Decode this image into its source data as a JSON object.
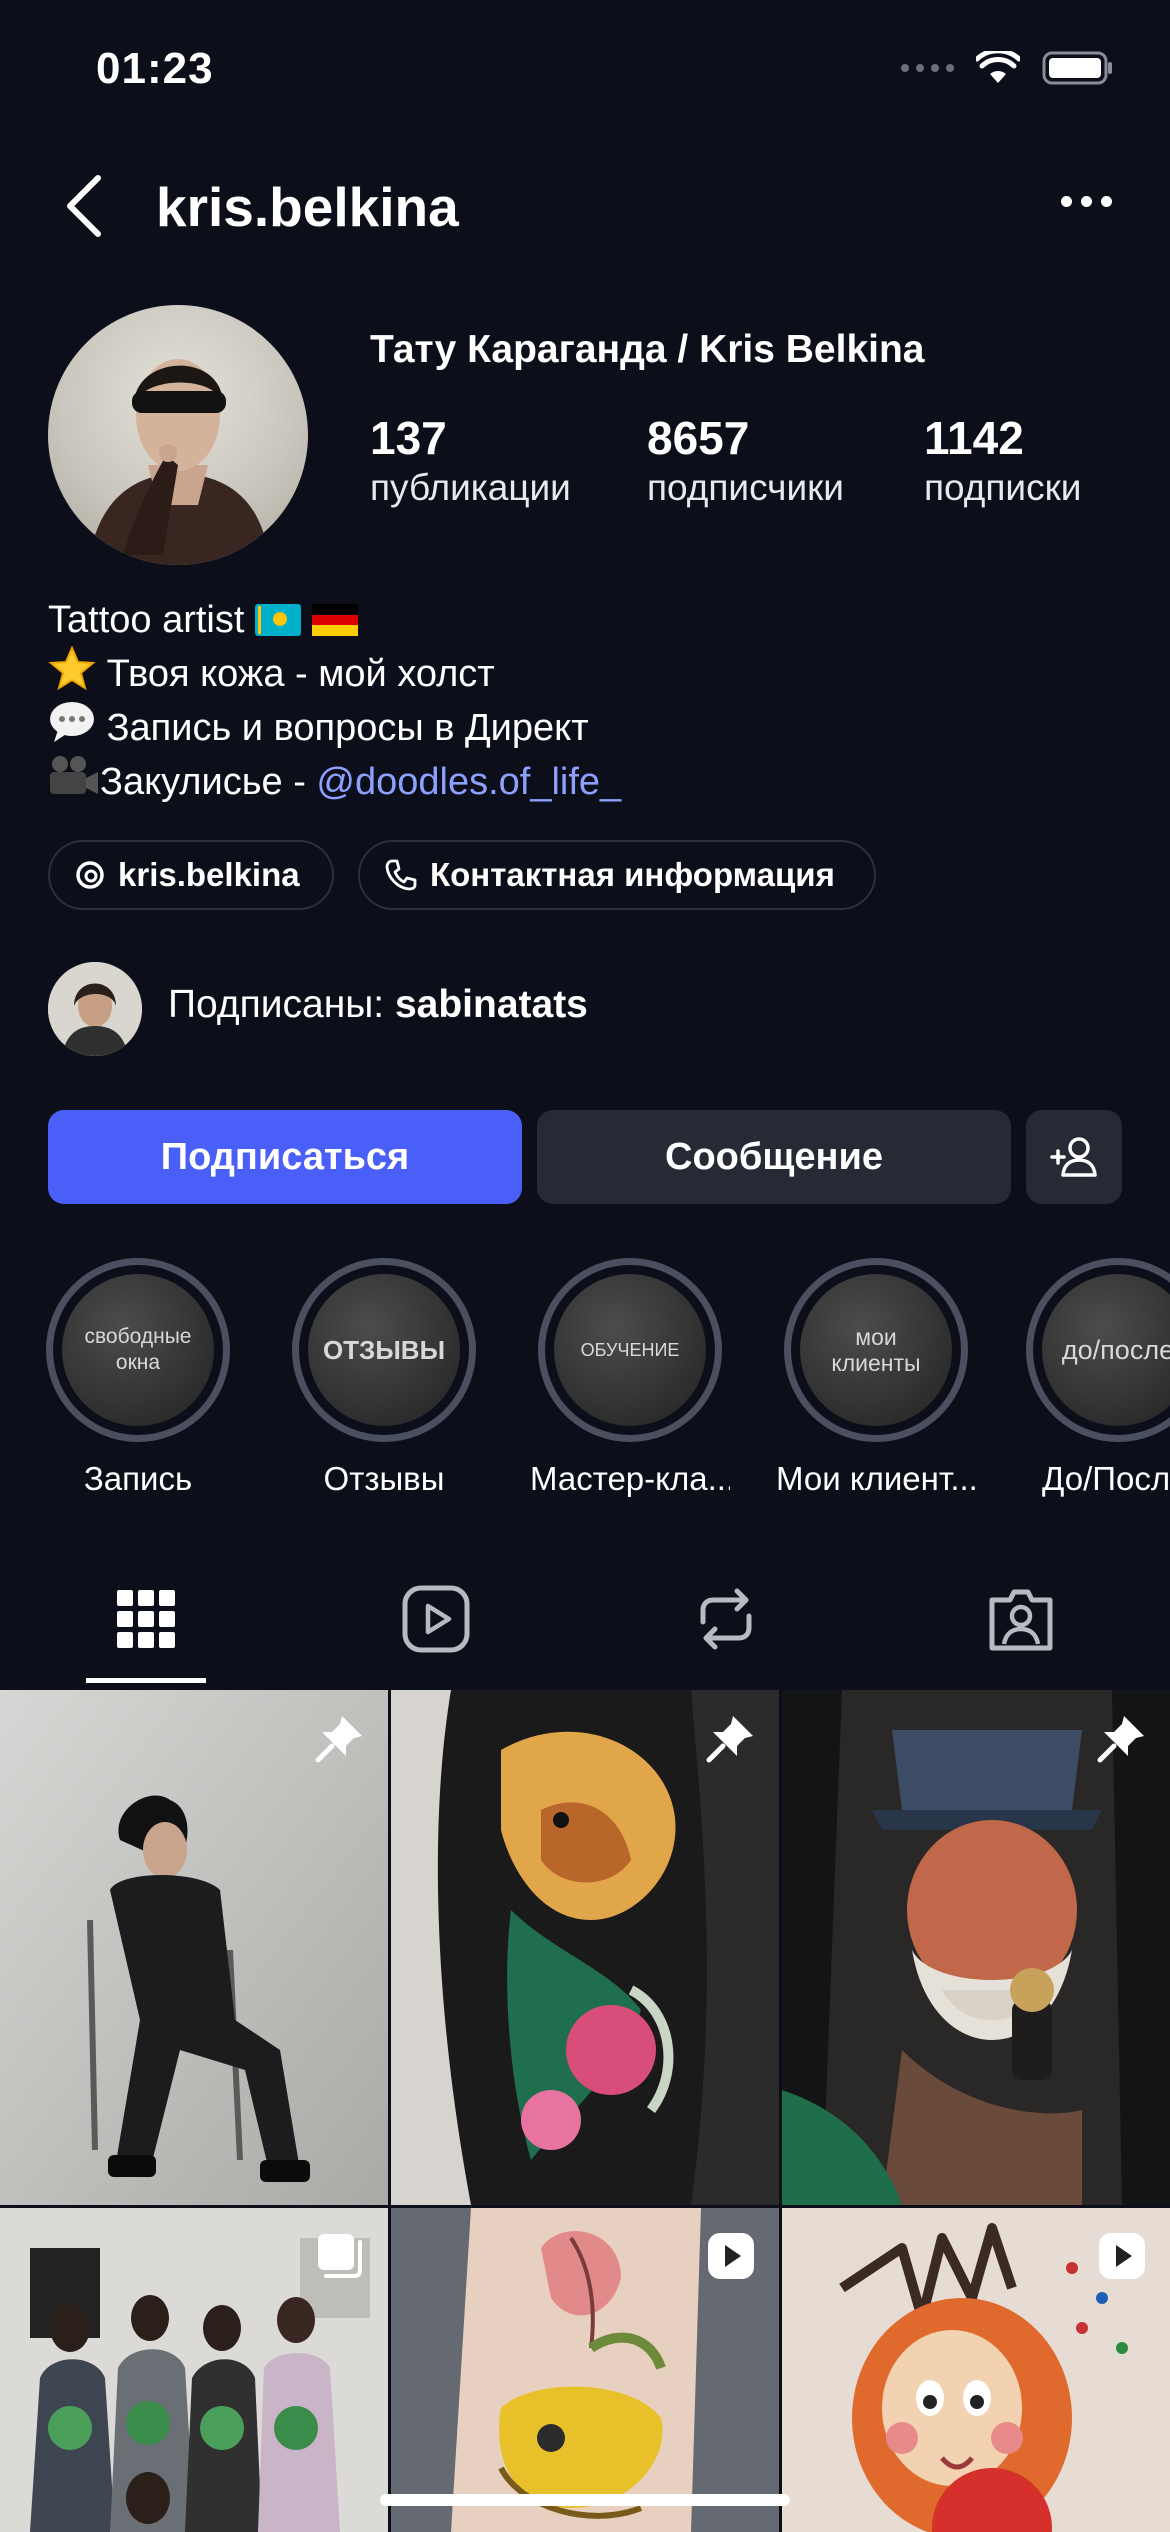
{
  "status_bar": {
    "time": "01:23"
  },
  "header": {
    "username": "kris.belkina"
  },
  "profile": {
    "full_name": "Тату Караганда / Kris Belkina",
    "stats": [
      {
        "value": "137",
        "label": "публикации"
      },
      {
        "value": "8657",
        "label": "подписчики"
      },
      {
        "value": "1142",
        "label": "подписки"
      }
    ],
    "bio": {
      "line1": "Tattoo artist",
      "line2": "Твоя кожа - мой холст",
      "line3": "Запись и вопросы в Директ",
      "line4_prefix": "Закулисье - ",
      "line4_link": "@doodles.of_life_"
    },
    "threads_chip": "kris.belkina",
    "contact_chip": "Контактная информация",
    "followed_by_prefix": "Подписаны: ",
    "followed_by_user": "sabinatats"
  },
  "actions": {
    "follow_label": "Подписаться",
    "message_label": "Сообщение"
  },
  "highlights": [
    {
      "cover_text": "свободные окна",
      "caption": "Запись"
    },
    {
      "cover_text": "ОТЗЫВЫ",
      "caption": "Отзывы"
    },
    {
      "cover_text": "ОБУЧЕНИЕ",
      "caption": "Мастер-кла..."
    },
    {
      "cover_text": "мои клиенты",
      "caption": "Мои клиент..."
    },
    {
      "cover_text": "до/после",
      "caption": "До/Посл"
    }
  ],
  "tabs": [
    "grid-icon",
    "reels-icon",
    "reposts-icon",
    "tagged-icon"
  ],
  "colors": {
    "accent": "#4a5ff7",
    "link": "#8ea0ff",
    "background": "#0c0f1a"
  }
}
